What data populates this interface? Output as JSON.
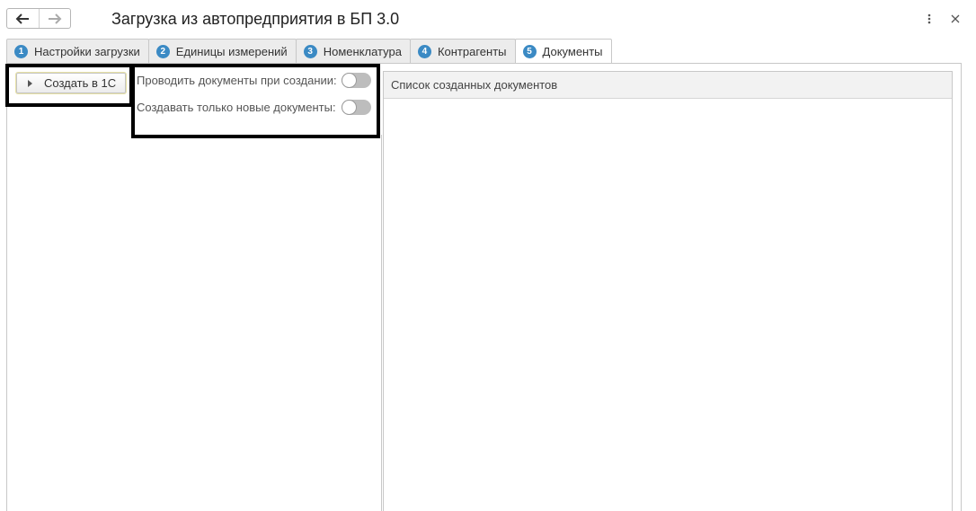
{
  "window": {
    "title": "Загрузка из автопредприятия в БП 3.0",
    "back_icon": "arrow-left-icon",
    "forward_icon": "arrow-right-icon",
    "menu_icon": "more-vertical-icon",
    "close_icon": "close-icon"
  },
  "tabs": [
    {
      "number": "1",
      "label": "Настройки загрузки"
    },
    {
      "number": "2",
      "label": "Единицы измерений"
    },
    {
      "number": "3",
      "label": "Номенклатура"
    },
    {
      "number": "4",
      "label": "Контрагенты"
    },
    {
      "number": "5",
      "label": "Документы",
      "active": true
    }
  ],
  "toolbar": {
    "create_label": "Создать в 1С"
  },
  "options": {
    "post_on_create": {
      "label": "Проводить документы при создании:",
      "on": false
    },
    "only_new": {
      "label": "Создавать только новые документы:",
      "on": false
    }
  },
  "list": {
    "header": "Список созданных документов"
  },
  "colors": {
    "accent": "#3b8ac4",
    "highlight_frame": "#000000"
  }
}
